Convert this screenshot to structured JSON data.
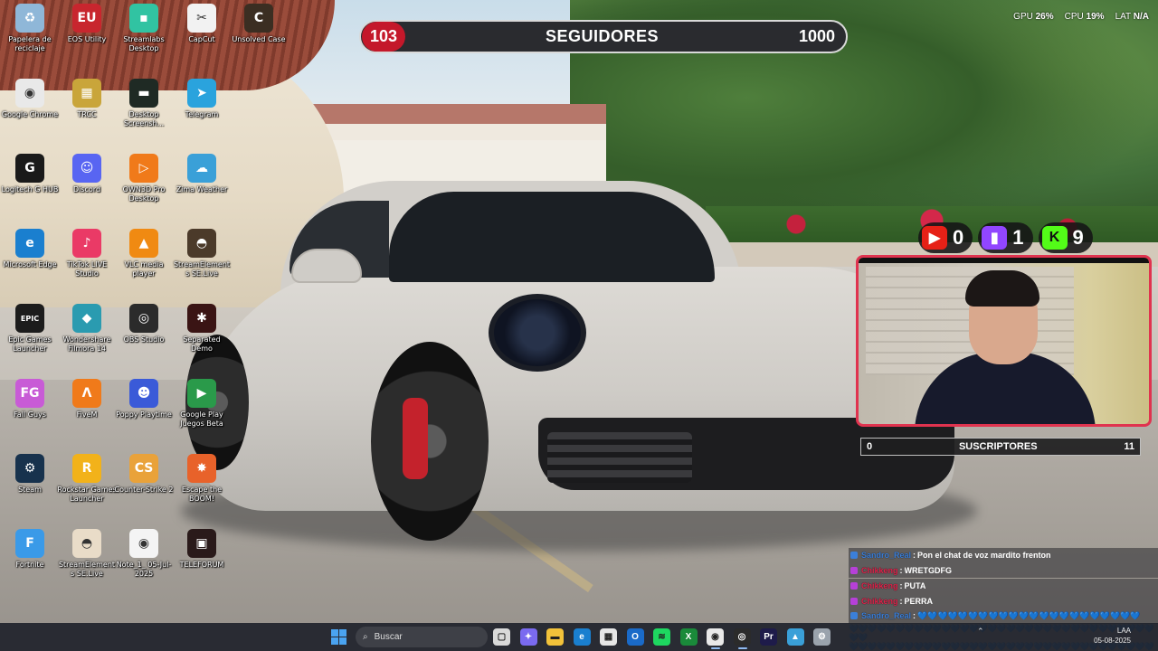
{
  "desktop": {
    "icons": [
      {
        "label": "Papelera de reciclaje",
        "icon": "recycle-bin-icon",
        "color": "#8fb7d8",
        "glyph": "♻"
      },
      {
        "label": "EOS Utility",
        "icon": "eos-utility-icon",
        "color": "#c8262e",
        "glyph": "EU"
      },
      {
        "label": "Streamlabs Desktop",
        "icon": "streamlabs-icon",
        "color": "#31c3a2",
        "glyph": "▪"
      },
      {
        "label": "CapCut",
        "icon": "capcut-icon",
        "color": "#f2f2f2",
        "glyph": "✂"
      },
      {
        "label": "Unsolved Case",
        "icon": "unsolved-case-icon",
        "color": "#3b2e22",
        "glyph": "C"
      },
      {
        "label": "Google Chrome",
        "icon": "chrome-icon",
        "color": "#e9e9e9",
        "glyph": "◉"
      },
      {
        "label": "TRCC",
        "icon": "trcc-icon",
        "color": "#c9a53a",
        "glyph": "▦"
      },
      {
        "label": "Desktop Screensh...",
        "icon": "screenshot-app-icon",
        "color": "#1f2a24",
        "glyph": "▬"
      },
      {
        "label": "Telegram",
        "icon": "telegram-icon",
        "color": "#2aa3dd",
        "glyph": "➤"
      },
      {
        "label": "Logitech G HUB",
        "icon": "logitech-g-hub-icon",
        "color": "#1a1a1a",
        "glyph": "G"
      },
      {
        "label": "Discord",
        "icon": "discord-icon",
        "color": "#5865f2",
        "glyph": "☺"
      },
      {
        "label": "OWN3D Pro Desktop",
        "icon": "own3d-icon",
        "color": "#f07a1a",
        "glyph": "▷"
      },
      {
        "label": "Zima Weather",
        "icon": "weather-icon",
        "color": "#3aa0d8",
        "glyph": "☁"
      },
      {
        "label": "Microsoft Edge",
        "icon": "edge-icon",
        "color": "#1a7fcf",
        "glyph": "e"
      },
      {
        "label": "TikTok LIVE Studio",
        "icon": "tiktok-live-icon",
        "color": "#ea3a66",
        "glyph": "♪"
      },
      {
        "label": "VLC media player",
        "icon": "vlc-icon",
        "color": "#f08a12",
        "glyph": "▲"
      },
      {
        "label": "StreamElements SE.Live",
        "icon": "streamelements-icon",
        "color": "#4b3a2a",
        "glyph": "◓"
      },
      {
        "label": "Epic Games Launcher",
        "icon": "epic-games-icon",
        "color": "#1c1c1c",
        "glyph": "EPIC"
      },
      {
        "label": "Wondershare Filmora 14",
        "icon": "filmora-icon",
        "color": "#2a9bb0",
        "glyph": "◆"
      },
      {
        "label": "OBS Studio",
        "icon": "obs-icon",
        "color": "#2b2b2b",
        "glyph": "◎"
      },
      {
        "label": "Separated Demo",
        "icon": "separated-demo-icon",
        "color": "#3a1414",
        "glyph": "✱"
      },
      {
        "label": "Fall Guys",
        "icon": "fall-guys-icon",
        "color": "#c85bd6",
        "glyph": "FG"
      },
      {
        "label": "FiveM",
        "icon": "fivem-icon",
        "color": "#f07a1a",
        "glyph": "Λ"
      },
      {
        "label": "Poppy Playtime",
        "icon": "poppy-playtime-icon",
        "color": "#3a5ad8",
        "glyph": "☻"
      },
      {
        "label": "Google Play Juegos Beta",
        "icon": "google-play-games-icon",
        "color": "#2a9a4a",
        "glyph": "▶"
      },
      {
        "label": "Steam",
        "icon": "steam-icon",
        "color": "#17324d",
        "glyph": "⚙"
      },
      {
        "label": "Rockstar Games Launcher",
        "icon": "rockstar-icon",
        "color": "#f2b21a",
        "glyph": "R"
      },
      {
        "label": "Counter-Strike 2",
        "icon": "counter-strike-icon",
        "color": "#e9a23a",
        "glyph": "CS"
      },
      {
        "label": "Escape the BOOM!",
        "icon": "escape-the-boom-icon",
        "color": "#e8622a",
        "glyph": "✸"
      },
      {
        "label": "Fortnite",
        "icon": "fortnite-icon",
        "color": "#3a9ae8",
        "glyph": "F"
      },
      {
        "label": "StreamElements SE.Live",
        "icon": "streamelements-icon",
        "color": "#e9dcc8",
        "glyph": "◓"
      },
      {
        "label": "Note_1_ 05-Jul-2025",
        "icon": "chrome-document-icon",
        "color": "#f4f4f4",
        "glyph": "◉"
      },
      {
        "label": "TELEFORUM",
        "icon": "teleforum-icon",
        "color": "#2a1a1a",
        "glyph": "▣"
      }
    ]
  },
  "followers_goal": {
    "current": "103",
    "label": "SEGUIDORES",
    "goal": "1000",
    "progress_fraction": 0.103,
    "bar_color": "#c4182a"
  },
  "performance": {
    "gpu_label": "GPU",
    "gpu_value": "26%",
    "cpu_label": "CPU",
    "cpu_value": "19%",
    "lat_label": "LAT",
    "lat_value": "N/A"
  },
  "platform_counts": [
    {
      "platform": "youtube",
      "icon": "youtube-icon",
      "color": "#e62117",
      "glyph": "▶",
      "count": "0"
    },
    {
      "platform": "twitch",
      "icon": "twitch-icon",
      "color": "#9146ff",
      "glyph": "▮",
      "count": "1"
    },
    {
      "platform": "kick",
      "icon": "kick-icon",
      "color": "#53fc18",
      "glyph": "K",
      "count": "9"
    }
  ],
  "subscribers_goal": {
    "current": "0",
    "label": "SUSCRIPTORES",
    "goal": "11"
  },
  "chat": {
    "messages": [
      {
        "user": "Sandro_Real",
        "user_color": "#3b7fd9",
        "badge_color": "#3b7fd9",
        "text": "Pon el chat de voz mardito frenton"
      },
      {
        "user": "Chikkeng",
        "user_color": "#e0234b",
        "badge_color": "#b640d8",
        "text": "WRETGDFG"
      },
      {
        "user": "Chikkeng",
        "user_color": "#e0234b",
        "badge_color": "#b640d8",
        "text": "PUTA"
      },
      {
        "user": "Chikkeng",
        "user_color": "#e0234b",
        "badge_color": "#b640d8",
        "text": "PERRA"
      },
      {
        "user": "Sandro_Real",
        "user_color": "#3b7fd9",
        "badge_color": "#3b7fd9",
        "text": "💙💙💙💙💙💙💙💙💙💙💙💙💙💙💙💙💙💙💙💙💙💙"
      }
    ],
    "heart_rows": [
      "💙💙💙💙💙💙💙💙💙💙💙💙💙💙💙💙💙💙💙💙💙💙💙💙💙💙💙💙💙💙💙💙💙💙💙",
      "💙💙💙💙💙💙💙💙💙💙💙💙💙💙💙💙💙💙💙💙💙💙💙💙💙💙💙💙💙💙💙💙💙"
    ]
  },
  "taskbar": {
    "search_placeholder": "Buscar",
    "apps": [
      {
        "name": "task-view",
        "icon": "task-view-icon",
        "color": "#d9d9d9",
        "glyph": "▢"
      },
      {
        "name": "copilot",
        "icon": "copilot-icon",
        "color": "#7a6af0",
        "glyph": "✦"
      },
      {
        "name": "file-explorer",
        "icon": "folder-icon",
        "color": "#f2c23a",
        "glyph": "▬"
      },
      {
        "name": "edge",
        "icon": "edge-icon",
        "color": "#1a7fcf",
        "glyph": "e"
      },
      {
        "name": "store",
        "icon": "store-icon",
        "color": "#e6e6e6",
        "glyph": "▦"
      },
      {
        "name": "outlook",
        "icon": "outlook-icon",
        "color": "#1a6ac8",
        "glyph": "O"
      },
      {
        "name": "spotify",
        "icon": "spotify-icon",
        "color": "#1ed760",
        "glyph": "≋"
      },
      {
        "name": "xbox",
        "icon": "xbox-icon",
        "color": "#1a8a3a",
        "glyph": "X"
      },
      {
        "name": "chrome",
        "icon": "chrome-icon",
        "color": "#e9e9e9",
        "glyph": "◉"
      },
      {
        "name": "obs",
        "icon": "obs-icon",
        "color": "#2b2b2b",
        "glyph": "◎"
      },
      {
        "name": "premiere",
        "icon": "premiere-icon",
        "color": "#1e1b4a",
        "glyph": "Pr"
      },
      {
        "name": "photos",
        "icon": "photos-icon",
        "color": "#3aa0d8",
        "glyph": "▲"
      },
      {
        "name": "settings",
        "icon": "settings-icon",
        "color": "#9aa3ad",
        "glyph": "⚙"
      }
    ],
    "language": "LAA",
    "date": "05-08-2025"
  }
}
